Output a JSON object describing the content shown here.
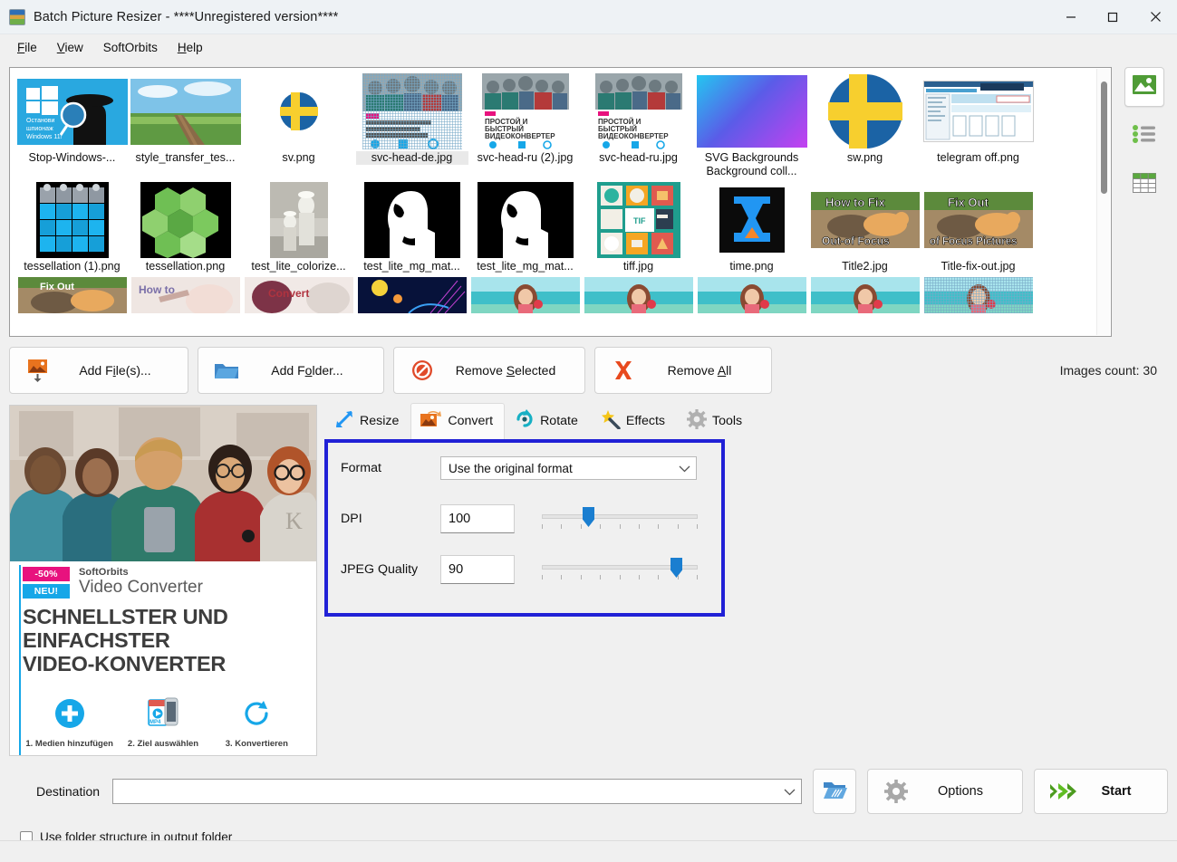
{
  "window": {
    "title": "Batch Picture Resizer - ****Unregistered version****",
    "app_icon": "app-icon",
    "controls": {
      "minimize": "minimize-icon",
      "maximize": "maximize-icon",
      "close": "close-icon"
    }
  },
  "menubar": [
    {
      "label": "File",
      "mnemonic": "F"
    },
    {
      "label": "View",
      "mnemonic": "V"
    },
    {
      "label": "SoftOrbits",
      "mnemonic": ""
    },
    {
      "label": "Help",
      "mnemonic": "H"
    }
  ],
  "thumbnails": {
    "rows": [
      [
        {
          "label": "Stop-Windows-...",
          "art": "stop-windows",
          "selected": false
        },
        {
          "label": "style_transfer_tes...",
          "art": "bridge-landscape",
          "selected": false
        },
        {
          "label": "sv.png",
          "art": "sweden-flag-circle",
          "selected": false
        },
        {
          "label": "svc-head-de.jpg",
          "art": "svc-head-de",
          "selected": true
        },
        {
          "label": "svc-head-ru (2).jpg",
          "art": "svc-head-ru",
          "selected": false
        },
        {
          "label": "svc-head-ru.jpg",
          "art": "svc-head-ru",
          "selected": false
        },
        {
          "label": "SVG Backgrounds Background coll...",
          "art": "gradient-purple",
          "selected": false
        },
        {
          "label": "sw.png",
          "art": "sweden-flag-circle",
          "selected": false
        },
        {
          "label": "telegram off.png",
          "art": "screenshot-ui",
          "selected": false
        }
      ],
      [
        {
          "label": "tessellation (1).png",
          "art": "puzzle-tessellation",
          "selected": false
        },
        {
          "label": "tessellation.png",
          "art": "hex-tessellation",
          "selected": false
        },
        {
          "label": "test_lite_colorize...",
          "art": "bw-children",
          "selected": false
        },
        {
          "label": "test_lite_mg_mat...",
          "art": "mask-silhouette",
          "selected": false
        },
        {
          "label": "test_lite_mg_mat...",
          "art": "mask-silhouette",
          "selected": false
        },
        {
          "label": "tiff.jpg",
          "art": "tif-icons-grid",
          "selected": false
        },
        {
          "label": "time.png",
          "art": "hourglass-logo",
          "selected": false
        },
        {
          "label": "Title2.jpg",
          "art": "cat-how-to-fix",
          "selected": false
        },
        {
          "label": "Title-fix-out.jpg",
          "art": "cat-fix-out",
          "selected": false
        }
      ],
      [
        {
          "label": "",
          "art": "cat-fix-out-2",
          "selected": false
        },
        {
          "label": "",
          "art": "how-to-face",
          "selected": false
        },
        {
          "label": "",
          "art": "convert-face",
          "selected": false
        },
        {
          "label": "",
          "art": "blue-lights",
          "selected": false
        },
        {
          "label": "",
          "art": "beach-woman",
          "selected": false
        },
        {
          "label": "",
          "art": "beach-woman",
          "selected": false
        },
        {
          "label": "",
          "art": "beach-woman",
          "selected": false
        },
        {
          "label": "",
          "art": "beach-woman",
          "selected": false
        },
        {
          "label": "",
          "art": "beach-woman-selected",
          "selected": true
        }
      ]
    ],
    "scrollbar": {
      "name": "thumbnails-vertical-scrollbar"
    }
  },
  "view_modes": [
    {
      "name": "view-mode-thumbnails",
      "icon": "image-icon",
      "active": true
    },
    {
      "name": "view-mode-list",
      "icon": "list-icon",
      "active": false
    },
    {
      "name": "view-mode-details",
      "icon": "table-icon",
      "active": false
    }
  ],
  "actions": [
    {
      "label": "Add File(s)...",
      "pre": "Add F",
      "mnemonic": "i",
      "post": "le(s)...",
      "icon": "add-image-icon"
    },
    {
      "label": "Add Folder...",
      "pre": "Add F",
      "mnemonic": "o",
      "post": "lder...",
      "icon": "folder-icon"
    },
    {
      "label": "Remove Selected",
      "pre": "Remove ",
      "mnemonic": "S",
      "post": "elected",
      "icon": "no-entry-icon"
    },
    {
      "label": "Remove All",
      "pre": "Remove ",
      "mnemonic": "A",
      "post": "ll",
      "icon": "red-x-icon"
    }
  ],
  "images_count": "Images count: 30",
  "preview": {
    "badge_discount": "-50%",
    "badge_new": "NEU!",
    "brand": "SoftOrbits",
    "brand_tm": "™",
    "product": "Video Converter",
    "headline_line1": "SCHNELLSTER UND",
    "headline_line2": "EINFACHSTER",
    "headline_line3": "VIDEO-KONVERTER",
    "steps": [
      {
        "caption": "1. Medien hinzufügen",
        "icon": "plus-circle-icon"
      },
      {
        "caption": "2. Ziel auswählen",
        "icon": "mp4-file-icon"
      },
      {
        "caption": "3. Konvertieren",
        "icon": "refresh-icon"
      }
    ]
  },
  "tabs": [
    {
      "label": "Resize",
      "icon": "resize-arrows-icon",
      "active": false
    },
    {
      "label": "Convert",
      "icon": "convert-image-icon",
      "active": true
    },
    {
      "label": "Rotate",
      "icon": "rotate-icon",
      "active": false
    },
    {
      "label": "Effects",
      "icon": "magic-wand-icon",
      "active": false
    },
    {
      "label": "Tools",
      "icon": "gear-icon",
      "active": false
    }
  ],
  "convert_panel": {
    "highlight_color": "#2121d6",
    "format": {
      "label": "Format",
      "value": "Use the original format",
      "chevron": "chevron-down-icon"
    },
    "dpi": {
      "label": "DPI",
      "value": "100",
      "slider_percent": 30,
      "tick_count": 9
    },
    "jpeg_quality": {
      "label": "JPEG Quality",
      "value": "90",
      "slider_percent": 90,
      "tick_count": 9
    }
  },
  "bottom": {
    "destination_label": "Destination",
    "destination_value": "",
    "destination_chevron": "chevron-down-icon",
    "browse_icon": "open-folder-icon",
    "options_label": "Options",
    "options_icon": "gear-icon",
    "start_label": "Start",
    "start_icon": "green-arrows-icon",
    "checkbox_label": "Use folder structure in output folder",
    "checkbox_checked": false
  }
}
